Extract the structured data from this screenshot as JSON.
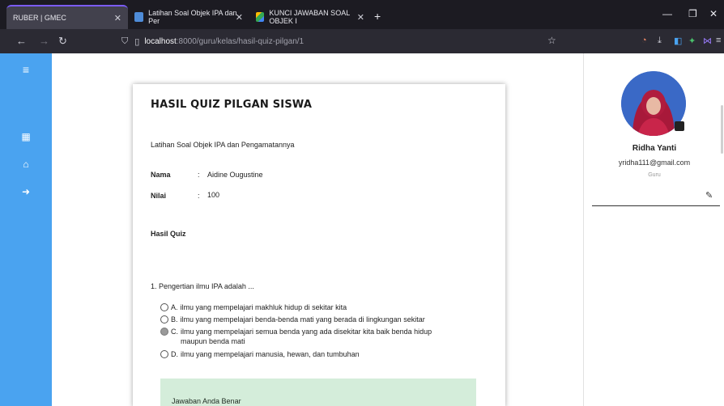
{
  "browser": {
    "tabs": [
      {
        "title": "RUBER | GMEC",
        "active": true
      },
      {
        "title": "Latihan Soal Objek IPA dan Per",
        "active": false
      },
      {
        "title": "KUNCI JAWABAN SOAL OBJEK I",
        "active": false
      }
    ],
    "url_host": "localhost",
    "url_path": ":8000/guru/kelas/hasil-quiz-pilgan/1"
  },
  "card": {
    "title": "HASIL QUIZ PILGAN SISWA",
    "quiz_name": "Latihan Soal Objek IPA dan Pengamatannya",
    "nama_label": "Nama",
    "nama_value": "Aidine Ougustine",
    "nilai_label": "Nilai",
    "nilai_value": "100",
    "colon": ":",
    "section": "Hasil Quiz",
    "question": "1.  Pengertian ilmu IPA adalah ...",
    "options": [
      {
        "letter": "A.",
        "text": "ilmu yang mempelajari makhluk hidup di sekitar kita",
        "selected": false
      },
      {
        "letter": "B.",
        "text": "ilmu yang mempelajari benda-benda mati yang berada di lingkungan sekitar",
        "selected": false
      },
      {
        "letter": "C.",
        "text": "ilmu yang mempelajari semua benda yang ada disekitar kita baik benda hidup maupun benda mati",
        "selected": true
      },
      {
        "letter": "D.",
        "text": "ilmu yang mempelajari manusia, hewan, dan tumbuhan",
        "selected": false
      }
    ],
    "result": "Jawaban Anda Benar"
  },
  "profile": {
    "name": "Ridha Yanti",
    "email": "yridha111@gmail.com",
    "role": "Guru"
  },
  "colors": {
    "sidebar": "#4aa3f0",
    "result_bg": "#d4edda",
    "tab_accent": "#7b5cff"
  },
  "icons": {
    "sidebar": [
      "menu-icon",
      "dashboard-icon",
      "home-icon",
      "logout-icon"
    ],
    "profile": [
      "camera-icon",
      "edit-icon"
    ]
  }
}
